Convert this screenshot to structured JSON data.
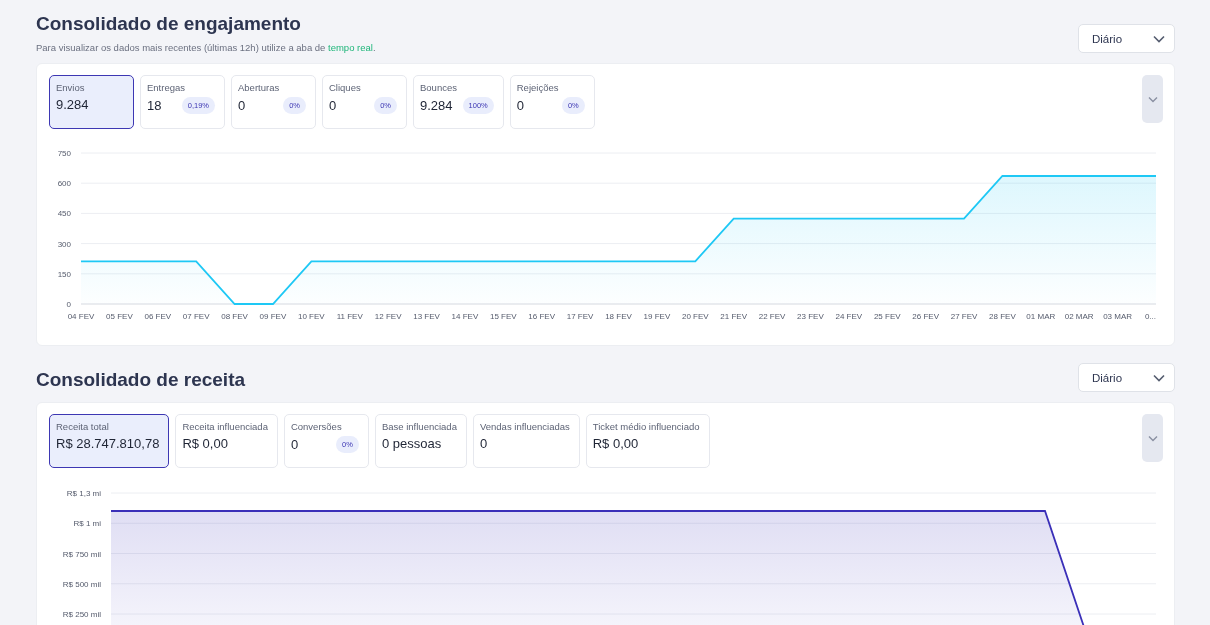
{
  "engagement": {
    "title": "Consolidado de engajamento",
    "subtitle": {
      "text": "Para visualizar os dados mais recentes (últimas 12h) utilize a aba de ",
      "link": "tempo real",
      "end": "."
    },
    "period": "Diário",
    "metrics": [
      {
        "label": "Envios",
        "value": "9.284",
        "selected": true
      },
      {
        "label": "Entregas",
        "value": "18",
        "badge": "0,19%",
        "selected": false
      },
      {
        "label": "Aberturas",
        "value": "0",
        "badge": "0%",
        "selected": false
      },
      {
        "label": "Cliques",
        "value": "0",
        "badge": "0%",
        "selected": false
      },
      {
        "label": "Bounces",
        "value": "9.284",
        "badge": "100%",
        "selected": false
      },
      {
        "label": "Rejeições",
        "value": "0",
        "badge": "0%",
        "selected": false
      }
    ],
    "chart_data": {
      "type": "area",
      "grid": true,
      "categories": [
        "04 FEV",
        "05 FEV",
        "06 FEV",
        "07 FEV",
        "08 FEV",
        "09 FEV",
        "10 FEV",
        "11 FEV",
        "12 FEV",
        "13 FEV",
        "14 FEV",
        "15 FEV",
        "16 FEV",
        "17 FEV",
        "18 FEV",
        "19 FEV",
        "20 FEV",
        "21 FEV",
        "22 FEV",
        "23 FEV",
        "24 FEV",
        "25 FEV",
        "26 FEV",
        "27 FEV",
        "28 FEV",
        "01 MAR",
        "02 MAR",
        "03 MAR",
        "0..."
      ],
      "ylim": [
        0,
        750
      ],
      "yticks": [
        0,
        150,
        300,
        450,
        600,
        750
      ],
      "series": [
        {
          "color": "#1ec8f5",
          "values": [
            212,
            212,
            212,
            212,
            0,
            0,
            212,
            212,
            212,
            212,
            212,
            212,
            212,
            212,
            212,
            212,
            212,
            424,
            424,
            424,
            424,
            424,
            424,
            424,
            636,
            636,
            636,
            636,
            636
          ]
        }
      ]
    }
  },
  "revenue": {
    "title": "Consolidado de receita",
    "period": "Diário",
    "metrics": [
      {
        "label": "Receita total",
        "value": "R$ 28.747.810,78",
        "selected": true
      },
      {
        "label": "Receita influenciada",
        "value": "R$ 0,00",
        "selected": false
      },
      {
        "label": "Conversões",
        "value": "0",
        "badge": "0%",
        "selected": false
      },
      {
        "label": "Base influenciada",
        "value": "0 pessoas",
        "selected": false
      },
      {
        "label": "Vendas influenciadas",
        "value": "0",
        "selected": false
      },
      {
        "label": "Ticket médio influenciado",
        "value": "R$ 0,00",
        "selected": false
      }
    ],
    "chart": {
      "y_labels": [
        "R$ 1,3 mi",
        "R$ 1 mi",
        "R$ 750 mil",
        "R$ 500 mil",
        "R$ 250 mil"
      ]
    }
  }
}
